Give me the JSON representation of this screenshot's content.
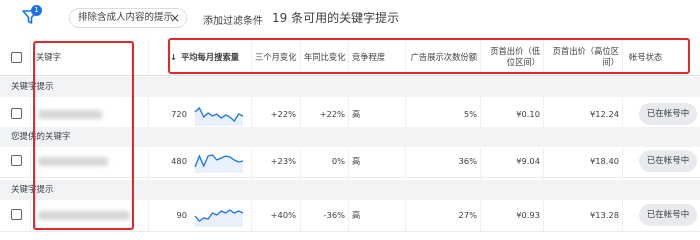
{
  "toolbar": {
    "filter_badge": "1",
    "chip_label": "排除含成人内容的提示",
    "chip_close": "×",
    "add_filter": "添加过滤条件",
    "count_title": "19 条可用的关键字提示"
  },
  "columns": {
    "keyword": "关键字",
    "avg_monthly": "平均每月搜索量",
    "sort_arrow": "↓",
    "three_month": "三个月变化",
    "yoy": "年同比变化",
    "competition": "竞争程度",
    "impression_share": "广告展示次数份额",
    "top_bid_low": "页首出价（低位区间）",
    "top_bid_high": "页首出价（高位区间）",
    "account_status": "帐号状态"
  },
  "groups": [
    {
      "label": "关键字提示",
      "rows": [
        {
          "volume": "720",
          "three_month": "+22%",
          "yoy": "+22%",
          "competition": "高",
          "share": "5%",
          "bid_low": "¥0.10",
          "bid_high": "¥12.24",
          "status": "已在帐号中",
          "trend": [
            0.6,
            0.8,
            0.35,
            0.55,
            0.4,
            0.5,
            0.3,
            0.45,
            0.35,
            0.15,
            0.5,
            0.4
          ]
        }
      ]
    },
    {
      "label": "您提供的关键字",
      "rows": [
        {
          "volume": "480",
          "three_month": "+23%",
          "yoy": "0%",
          "competition": "高",
          "share": "36%",
          "bid_low": "¥9.04",
          "bid_high": "¥18.40",
          "status": "已在帐号中",
          "trend": [
            0.2,
            0.75,
            0.25,
            0.75,
            0.8,
            0.55,
            0.65,
            0.75,
            0.7,
            0.55,
            0.45,
            0.5
          ]
        }
      ]
    },
    {
      "label": "关键字提示",
      "rows": [
        {
          "volume": "90",
          "three_month": "+40%",
          "yoy": "-36%",
          "competition": "高",
          "share": "27%",
          "bid_low": "¥0.93",
          "bid_high": "¥13.28",
          "status": "已在帐号中",
          "trend": [
            0.45,
            0.2,
            0.35,
            0.3,
            0.6,
            0.5,
            0.7,
            0.6,
            0.75,
            0.6,
            0.7,
            0.6
          ]
        }
      ]
    }
  ],
  "colors": {
    "accent": "#1a73e8",
    "annotation": "#e3262a",
    "sparkline": "#1a73e8"
  }
}
